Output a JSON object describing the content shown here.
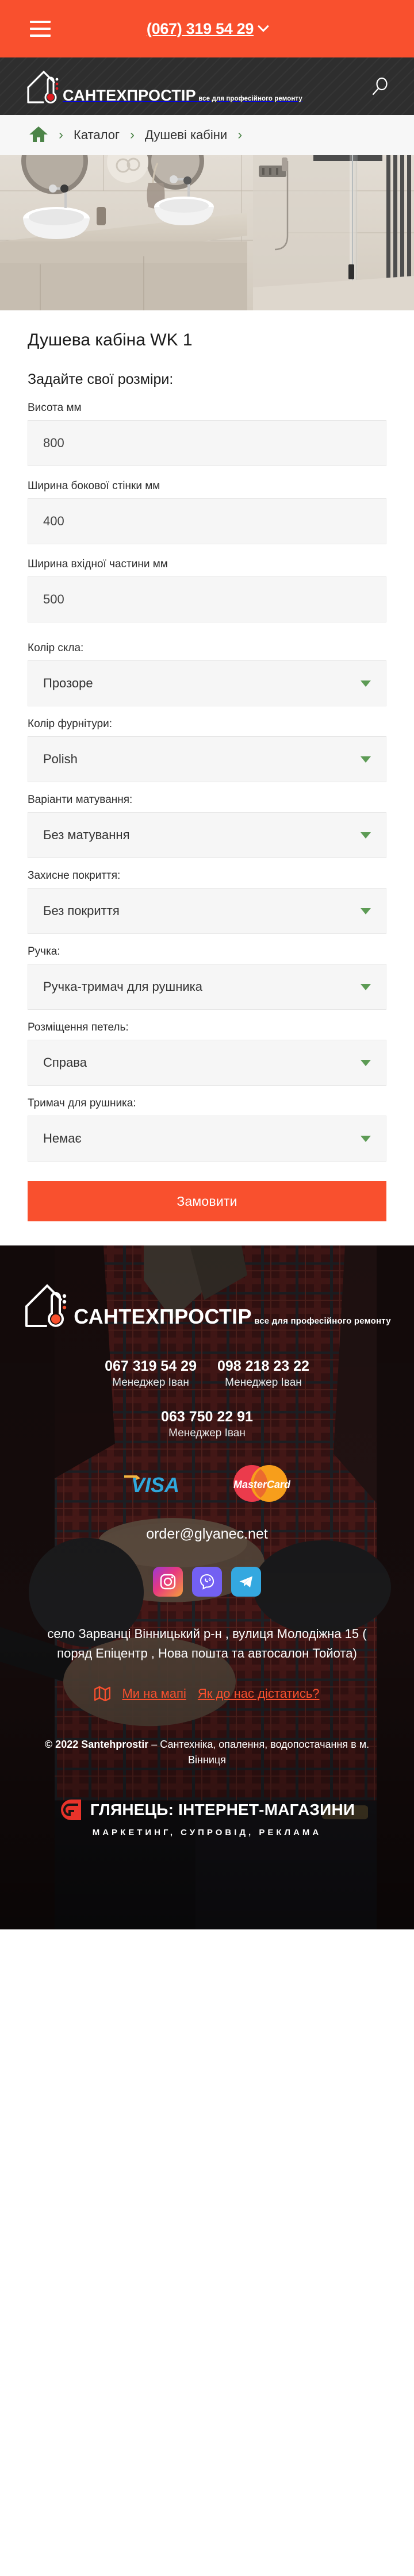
{
  "topbar": {
    "menu_icon": "hamburger-menu-icon",
    "phone": "(067) 319 54 29",
    "caret_icon": "chevron-down-icon"
  },
  "header": {
    "logo_title": "САНТЕХПРОСТІР",
    "logo_subtitle": "все для професійного ремонту",
    "search_icon": "search-icon"
  },
  "breadcrumb": {
    "home_icon": "home-icon",
    "separator": "›",
    "items": [
      {
        "label": "Каталог"
      },
      {
        "label": "Душеві кабіни"
      }
    ]
  },
  "product": {
    "title": "Душева кабіна WK 1",
    "form_heading": "Задайте свої розміри:",
    "dimension_fields": [
      {
        "label": "Висота мм",
        "value": "800"
      },
      {
        "label": "Ширина бокової стінки мм",
        "value": "400"
      },
      {
        "label": "Ширина вхідної частини мм",
        "value": "500"
      }
    ],
    "select_fields": [
      {
        "label": "Колір скла:",
        "value": "Прозоре"
      },
      {
        "label": "Колір фурнітури:",
        "value": "Polish"
      },
      {
        "label": "Варіанти матування:",
        "value": "Без матування"
      },
      {
        "label": "Захисне покриття:",
        "value": "Без покриття"
      },
      {
        "label": "Ручка:",
        "value": "Ручка-тримач для рушника"
      },
      {
        "label": "Розміщення петель:",
        "value": "Справа"
      },
      {
        "label": "Тримач для рушника:",
        "value": "Немає"
      }
    ],
    "order_button": "Замовити"
  },
  "footer": {
    "logo_title": "САНТЕХПРОСТІР",
    "logo_subtitle": "все для професійного ремонту",
    "phones": [
      {
        "number": "067 319 54 29",
        "manager": "Менеджер Іван"
      },
      {
        "number": "098 218 23 22",
        "manager": "Менеджер Іван"
      },
      {
        "number": "063 750 22 91",
        "manager": "Менеджер Іван"
      }
    ],
    "payment_cards": [
      {
        "name": "visa-logo",
        "label": "VISA"
      },
      {
        "name": "mastercard-logo",
        "label": "MasterCard"
      }
    ],
    "email": "order@glyanec.net",
    "socials": [
      {
        "name": "instagram-icon",
        "label": "Instagram"
      },
      {
        "name": "viber-icon",
        "label": "Viber"
      },
      {
        "name": "telegram-icon",
        "label": "Telegram"
      }
    ],
    "address": "село Зарванці Вінницький р-н , вулиця Молодіжна 15 ( поряд Епіцентр , Нова пошта та автосалон Тойота)",
    "map_icon": "map-icon",
    "map_links": [
      {
        "label": "Ми на мапі"
      },
      {
        "label": "Як до нас дістатись?"
      }
    ],
    "copyright_bold": "© 2022 Santehprostir",
    "copyright_rest": " – Сантехніка, опалення, водопостачання в м. Вінниця",
    "developer": {
      "logo": "glyanec-g-logo",
      "title": "ГЛЯНЕЦЬ: ІНТЕРНЕТ-МАГАЗИНИ",
      "subtitle": "МАРКЕТИНГ, СУПРОВІД, РЕКЛАМА"
    }
  },
  "colors": {
    "brand_orange": "#f9502e",
    "dark_header": "#2e2e2e",
    "accent_green": "#5d9b55",
    "field_bg": "#f6f6f6"
  }
}
